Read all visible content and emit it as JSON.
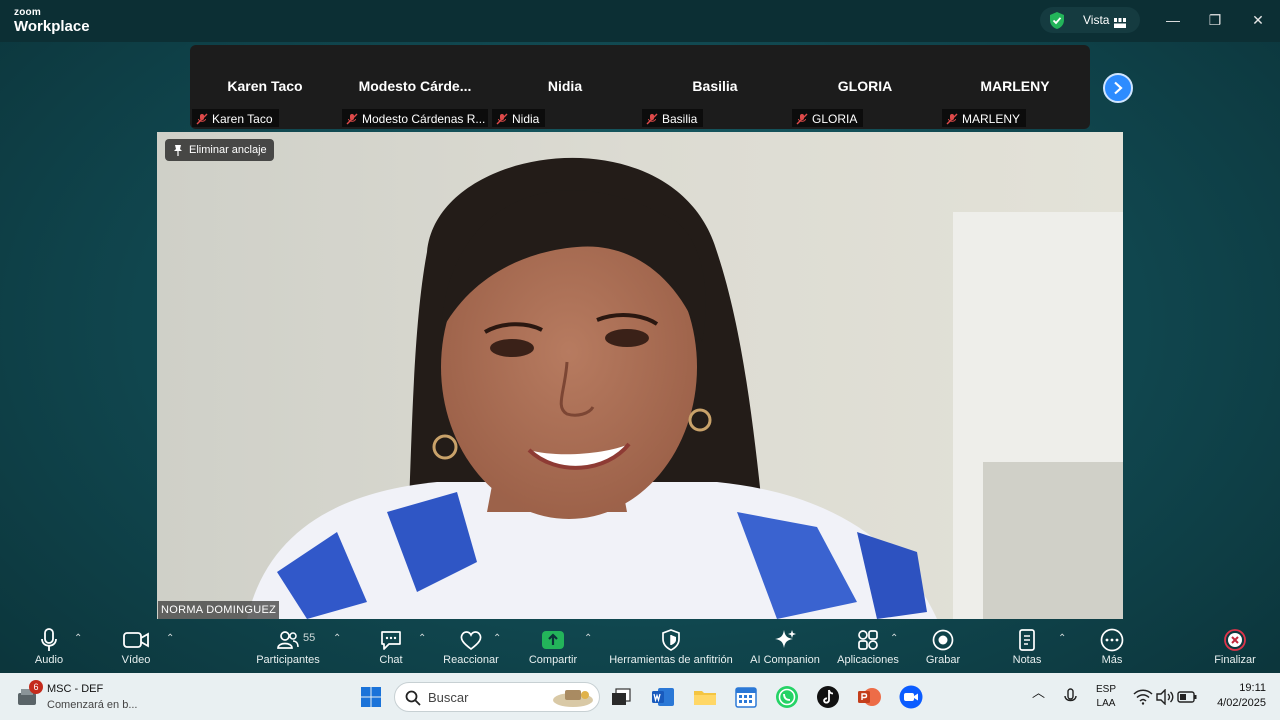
{
  "app": {
    "logo_top": "zoom",
    "logo_bottom": "Workplace"
  },
  "titlebar": {
    "view_label": "Vista",
    "minimize": "—",
    "restore": "❐",
    "close": "✕"
  },
  "participants_strip": [
    {
      "tile_name": "Karen Taco",
      "tag": "Karen Taco"
    },
    {
      "tile_name": "Modesto  Cárde...",
      "tag": "Modesto Cárdenas R..."
    },
    {
      "tile_name": "Nidia",
      "tag": "Nidia"
    },
    {
      "tile_name": "Basilia",
      "tag": "Basilia"
    },
    {
      "tile_name": "GLORIA",
      "tag": "GLORIA"
    },
    {
      "tile_name": "MARLENY",
      "tag": "MARLENY"
    }
  ],
  "main_video": {
    "unpin_label": "Eliminar anclaje",
    "speaker_name": "NORMA DOMINGUEZ"
  },
  "toolbar": {
    "audio": "Audio",
    "video": "Vídeo",
    "participants": "Participantes",
    "participants_count": "55",
    "chat": "Chat",
    "react": "Reaccionar",
    "share": "Compartir",
    "host_tools": "Herramientas de anfitrión",
    "ai_companion": "AI Companion",
    "apps": "Aplicaciones",
    "record": "Grabar",
    "notes": "Notas",
    "more": "Más",
    "end": "Finalizar"
  },
  "taskbar": {
    "notification_count": "6",
    "notification_title": "MSC - DEF",
    "notification_sub": "Comenzará en b...",
    "search_placeholder": "Buscar",
    "lang_top": "ESP",
    "lang_bottom": "LAA",
    "time": "19:11",
    "date": "4/02/2025"
  },
  "colors": {
    "accent_blue": "#2d8cff",
    "share_green": "#23b45a",
    "end_red": "#e0344a"
  }
}
